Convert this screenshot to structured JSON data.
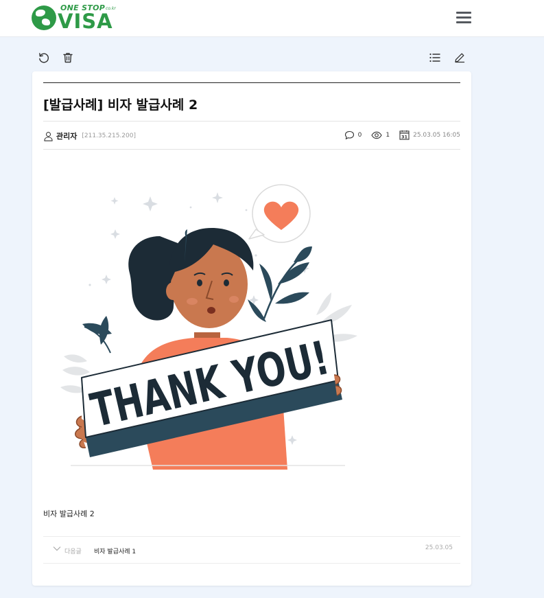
{
  "header": {
    "logo_top": "ONE STOP",
    "logo_co": "co.kr",
    "logo_main": "VISA"
  },
  "toolbar": {
    "refresh_icon": "refresh-icon",
    "delete_icon": "trash-icon",
    "list_icon": "list-icon",
    "write_icon": "pencil-icon"
  },
  "post": {
    "title": "[발급사례] 비자 발급사례 2",
    "author": "관리자",
    "ip": "[211.35.215.200]",
    "comments": "0",
    "views": "1",
    "calendar_day": "31",
    "datetime": "25.03.05 16:05",
    "image_text": "THANK YOU!",
    "body": "비자 발급사례 2"
  },
  "nav": {
    "next_label": "다음글",
    "next_title": "비자 발급사례 1",
    "next_date": "25.03.05"
  },
  "colors": {
    "brand": "#2e9a47",
    "shirt": "#f47d5a",
    "skin": "#c9784f",
    "hair": "#1c2b36",
    "leaf": "#2b4a5b"
  }
}
